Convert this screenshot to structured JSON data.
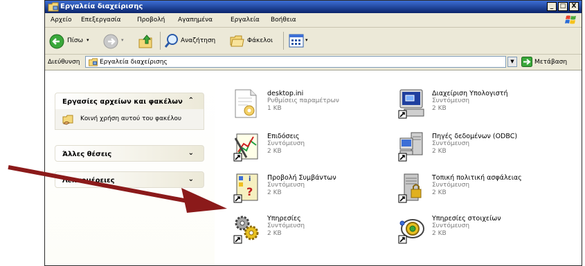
{
  "window": {
    "title": "Εργαλεία διαχείρισης",
    "controls": {
      "minimize": "_",
      "maximize": "□",
      "close": "X"
    }
  },
  "menu": [
    "Αρχείο",
    "Επεξεργασία",
    "Προβολή",
    "Αγαπημένα",
    "Εργαλεία",
    "Βοήθεια"
  ],
  "toolbar": {
    "back_label": "Πίσω",
    "search_label": "Αναζήτηση",
    "folders_label": "Φάκελοι"
  },
  "address": {
    "label": "Διεύθυνση",
    "value": "Εργαλεία διαχείρισης",
    "go_label": "Μετάβαση"
  },
  "taskpane": {
    "panels": [
      {
        "title": "Εργασίες αρχείων και φακέλων",
        "chevron": "⌃",
        "links": [
          "Κοινή χρήση αυτού του φακέλου"
        ]
      },
      {
        "title": "Άλλες θέσεις",
        "chevron": "⌄"
      },
      {
        "title": "Λεπτομέρειες",
        "chevron": "⌄"
      }
    ]
  },
  "files": [
    {
      "name": "desktop.ini",
      "type": "Ρυθμίσεις παραμέτρων",
      "size": "1 KB",
      "icon": "ini-settings-icon"
    },
    {
      "name": "Διαχείριση Υπολογιστή",
      "type": "Συντόμευση",
      "size": "2 KB",
      "icon": "computer-management-icon"
    },
    {
      "name": "Επιδόσεις",
      "type": "Συντόμευση",
      "size": "2 KB",
      "icon": "performance-icon"
    },
    {
      "name": "Πηγές δεδομένων (ODBC)",
      "type": "Συντόμευση",
      "size": "2 KB",
      "icon": "odbc-icon"
    },
    {
      "name": "Προβολή Συμβάντων",
      "type": "Συντόμευση",
      "size": "2 KB",
      "icon": "event-viewer-icon"
    },
    {
      "name": "Τοπική πολιτική ασφάλειας",
      "type": "Συντόμευση",
      "size": "2 KB",
      "icon": "local-security-policy-icon"
    },
    {
      "name": "Υπηρεσίες",
      "type": "Συντόμευση",
      "size": "2 KB",
      "icon": "services-icon"
    },
    {
      "name": "Υπηρεσίες στοιχείων",
      "type": "Συντόμευση",
      "size": "2 KB",
      "icon": "component-services-icon"
    }
  ],
  "colors": {
    "titlebar": "#0a246a",
    "window_bg": "#ece9d8",
    "annotation_arrow": "#8b1a1a"
  }
}
